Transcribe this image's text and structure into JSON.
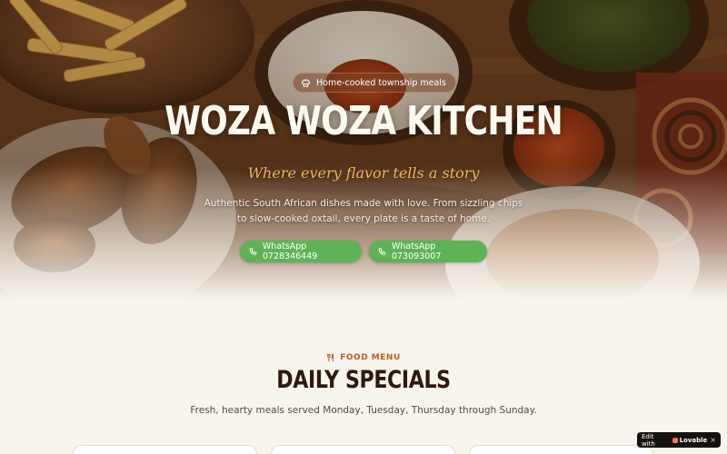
{
  "hero": {
    "badge_label": "Home-cooked township meals",
    "title": "WOZA WOZA KITCHEN",
    "tagline": "Where every flavor tells a story",
    "description": "Authentic South African dishes made with love. From sizzling chips to slow-cooked oxtail, every plate is a taste of home.",
    "buttons": [
      {
        "label": "WhatsApp 0728346449",
        "icon": "phone-icon"
      },
      {
        "label": "WhatsApp 073093007",
        "icon": "phone-icon"
      }
    ]
  },
  "menu": {
    "kicker": "FOOD MENU",
    "kicker_icon": "utensils-icon",
    "title": "DAILY SPECIALS",
    "description": "Fresh, hearty meals served Monday, Tuesday, Thursday through Sunday."
  },
  "lovable": {
    "edit_label": "Edit with",
    "brand": "Lovable",
    "close": "×"
  },
  "colors": {
    "accent_green": "#5fb356",
    "tagline_gold": "#f0b458",
    "kicker_orange": "#c25b22",
    "heading_dark": "#2e1a0c",
    "page_bg": "#f8f4ee"
  }
}
